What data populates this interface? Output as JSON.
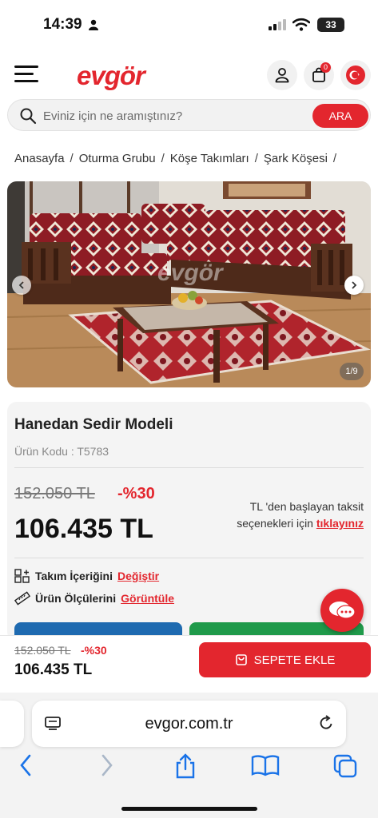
{
  "status_bar": {
    "time": "14:39",
    "battery": "33"
  },
  "header": {
    "logo": "evgör",
    "cart_count": "0"
  },
  "search": {
    "placeholder": "Eviniz için ne aramıştınız?",
    "button": "ARA"
  },
  "breadcrumb": [
    "Anasayfa",
    "Oturma Grubu",
    "Köşe Takımları",
    "Şark Köşesi"
  ],
  "gallery": {
    "counter": "1/9",
    "watermark": "evgör"
  },
  "product": {
    "title": "Hanedan Sedir Modeli",
    "code": "Ürün Kodu : T5783",
    "old_price": "152.050 TL",
    "discount": "-%30",
    "price": "106.435 TL",
    "installment_text_1": "TL 'den başlayan taksit",
    "installment_text_2": "seçenekleri için",
    "installment_link": "tıklayınız",
    "set_label": "Takım İçeriğini",
    "set_link": "Değiştir",
    "size_label": "Ürün Ölçülerini",
    "size_link": "Görüntüle"
  },
  "sticky_bar": {
    "old_price": "152.050 TL",
    "discount": "-%30",
    "price": "106.435 TL",
    "add_to_cart": "SEPETE EKLE"
  },
  "browser": {
    "url": "evgor.com.tr"
  },
  "colors": {
    "brand": "#e3262e",
    "blue_button": "#1e6ab0",
    "green_button": "#1f9a4a"
  }
}
